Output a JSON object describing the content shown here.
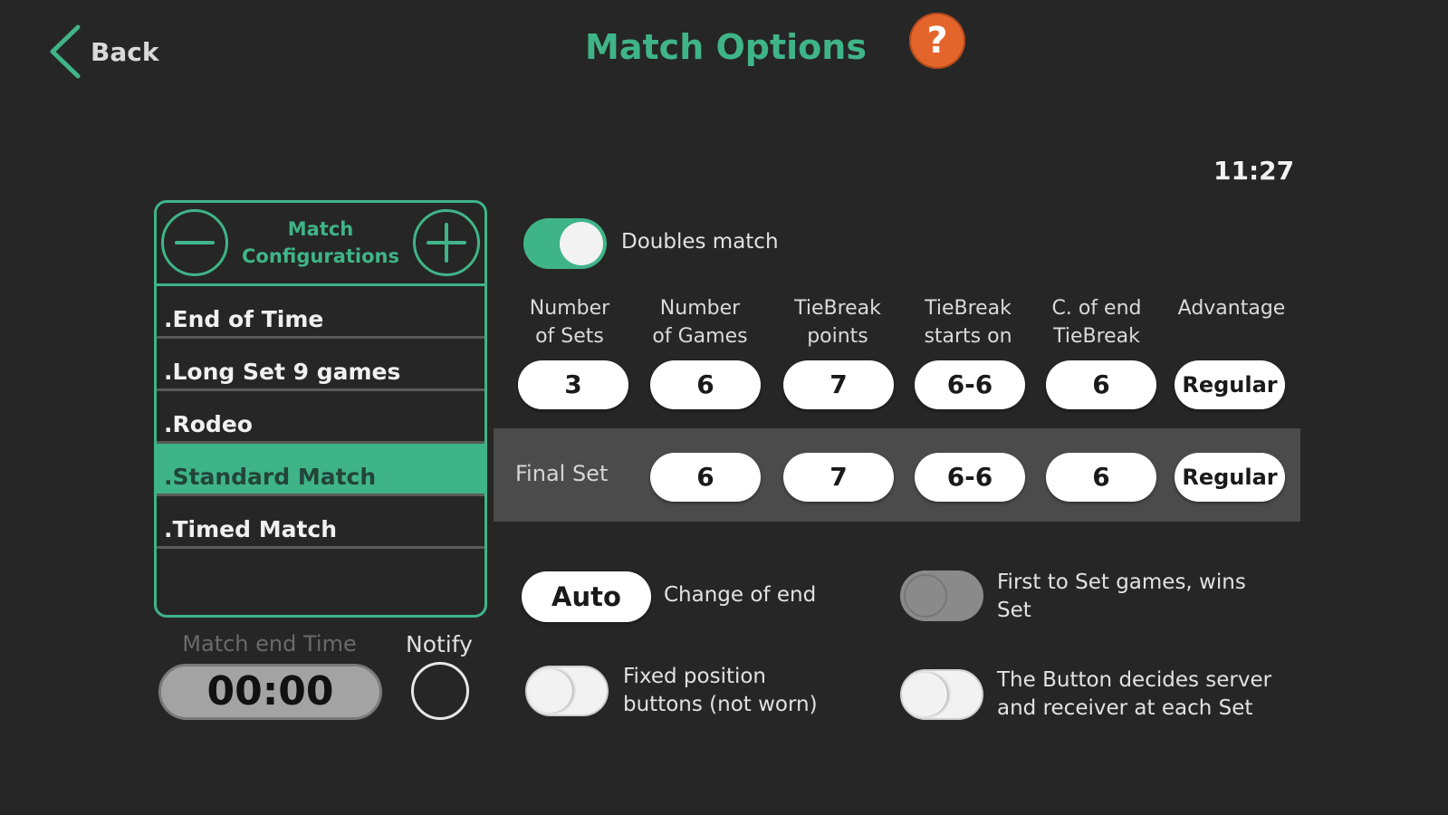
{
  "header": {
    "back_label": "Back",
    "title": "Match Options",
    "help_label": "?",
    "clock": "11:27"
  },
  "colors": {
    "accent": "#3fb489",
    "help": "#e4652c",
    "background": "#262626"
  },
  "config": {
    "title_line1": "Match",
    "title_line2": "Configurations",
    "items": [
      {
        "label": ".End of Time"
      },
      {
        "label": ".Long Set 9 games"
      },
      {
        "label": ".Rodeo"
      },
      {
        "label": ".Standard Match"
      },
      {
        "label": ".Timed Match"
      }
    ],
    "selected": ".Standard Match"
  },
  "end_time": {
    "label": "Match end Time",
    "value": "00:00",
    "notify_label": "Notify"
  },
  "doubles": {
    "label": "Doubles match",
    "on": true
  },
  "columns": [
    {
      "line1": "Number",
      "line2": "of Sets"
    },
    {
      "line1": "Number",
      "line2": "of Games"
    },
    {
      "line1": "TieBreak",
      "line2": "points"
    },
    {
      "line1": "TieBreak",
      "line2": "starts on"
    },
    {
      "line1": "C. of end",
      "line2": "TieBreak"
    },
    {
      "line1": "",
      "line2": "Advantage"
    }
  ],
  "regular_row": [
    "3",
    "6",
    "7",
    "6-6",
    "6",
    "Regular"
  ],
  "final_set": {
    "label": "Final Set",
    "values": [
      "6",
      "7",
      "6-6",
      "6",
      "Regular"
    ]
  },
  "options": {
    "change_of_end_value": "Auto",
    "change_of_end_label": "Change of end",
    "first_to_set_line1": "First to Set games, wins",
    "first_to_set_line2": "Set",
    "fixed_line1": "Fixed position",
    "fixed_line2": "buttons (not worn)",
    "button_decides_line1": "The Button decides server",
    "button_decides_line2": "and receiver at each Set"
  }
}
